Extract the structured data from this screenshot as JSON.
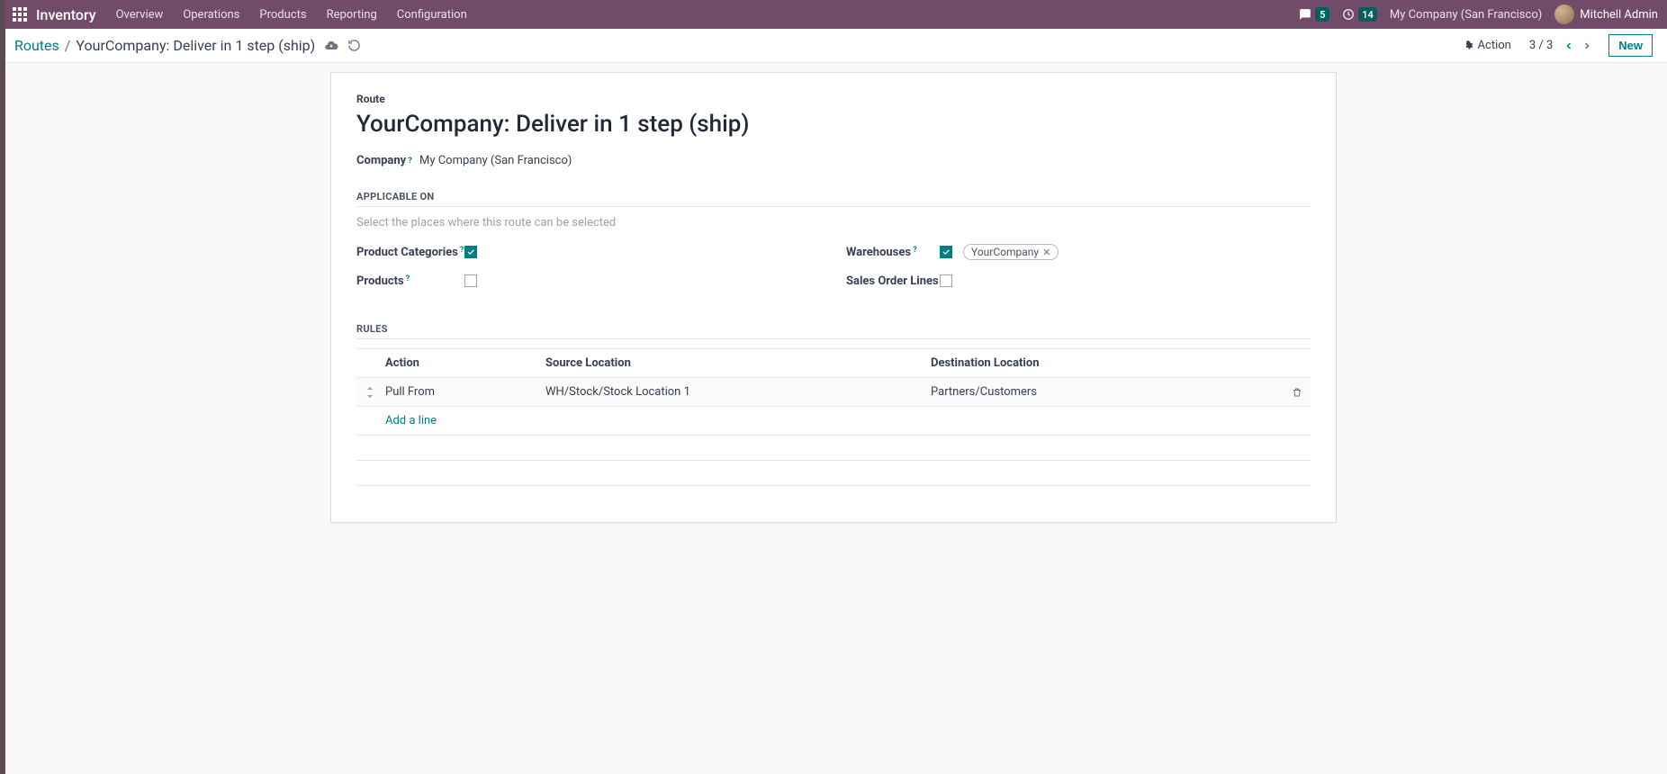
{
  "topnav": {
    "brand": "Inventory",
    "menu": [
      "Overview",
      "Operations",
      "Products",
      "Reporting",
      "Configuration"
    ],
    "messages_count": "5",
    "activities_count": "14",
    "company": "My Company (San Francisco)",
    "user": "Mitchell Admin"
  },
  "controlbar": {
    "breadcrumb_root": "Routes",
    "breadcrumb_current": "YourCompany: Deliver in 1 step (ship)",
    "action_label": "Action",
    "pager": "3 / 3",
    "new_label": "New"
  },
  "form": {
    "route_label": "Route",
    "title": "YourCompany: Deliver in 1 step (ship)",
    "company_label": "Company",
    "company_value": "My Company (San Francisco)",
    "applicable_on": "Applicable On",
    "applicable_hint": "Select the places where this route can be selected",
    "product_categories_label": "Product Categories",
    "product_categories_checked": true,
    "products_label": "Products",
    "products_checked": false,
    "warehouses_label": "Warehouses",
    "warehouses_checked": true,
    "warehouse_tag": "YourCompany",
    "sales_order_lines_label": "Sales Order Lines",
    "sales_order_lines_checked": false,
    "rules_label": "Rules",
    "rules_headers": {
      "action": "Action",
      "source": "Source Location",
      "dest": "Destination Location"
    },
    "rules": [
      {
        "action": "Pull From",
        "source": "WH/Stock/Stock Location 1",
        "dest": "Partners/Customers"
      }
    ],
    "add_line": "Add a line"
  }
}
